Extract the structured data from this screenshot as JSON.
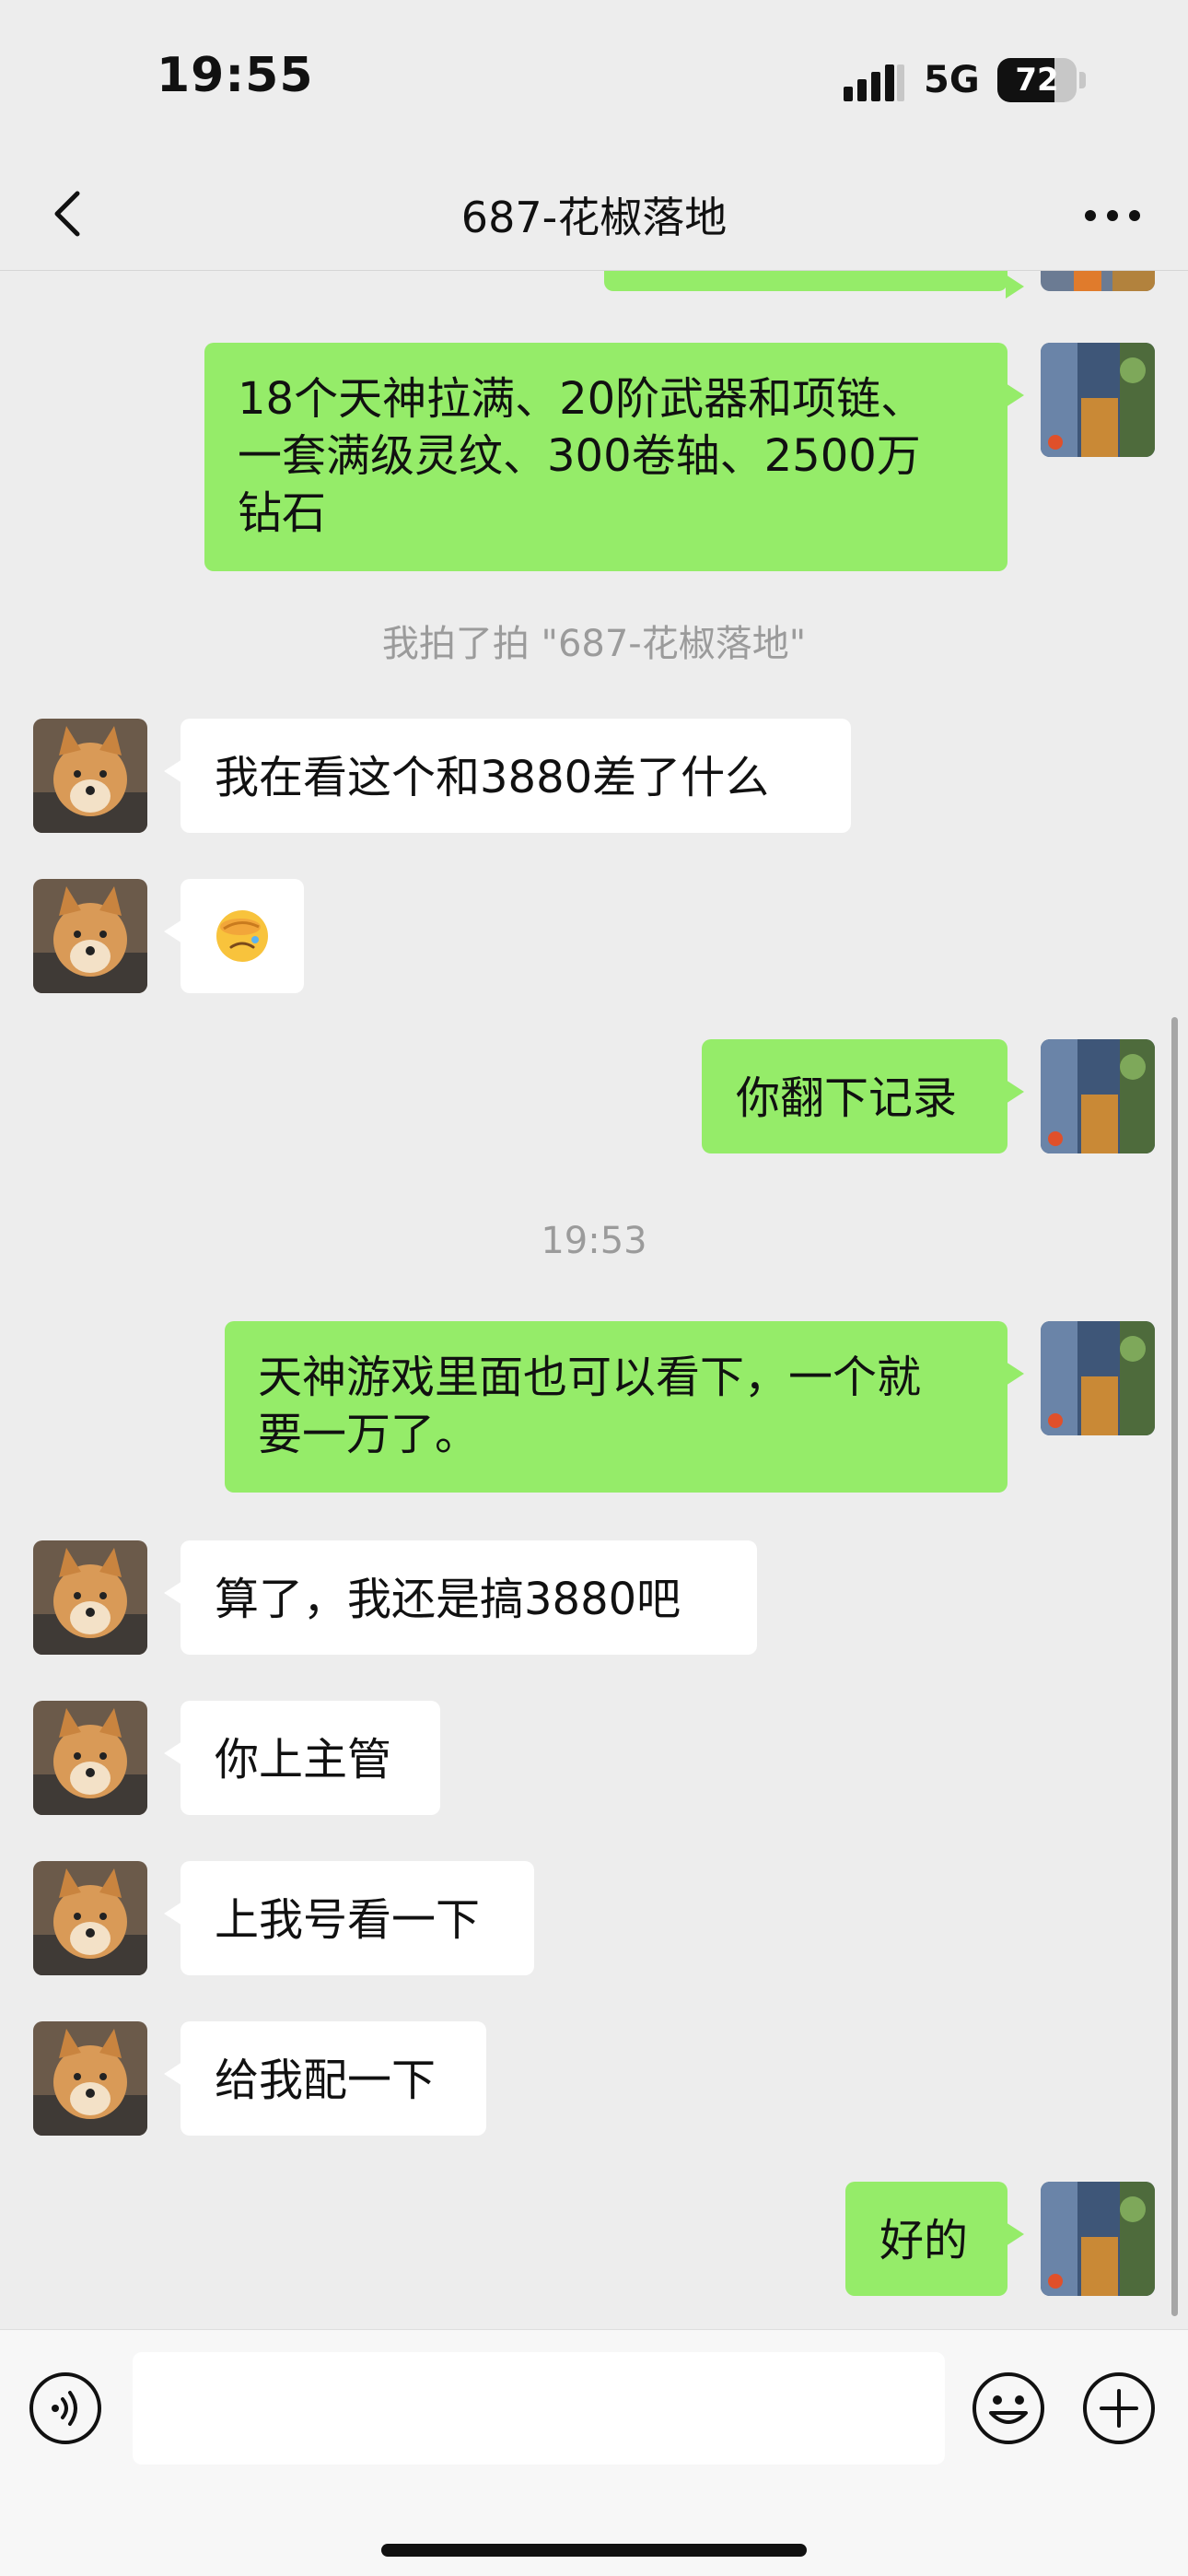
{
  "status_bar": {
    "time": "19:55",
    "network": "5G",
    "battery_percent": "72",
    "battery_level": 0.72
  },
  "nav": {
    "title": "687-花椒落地",
    "back_icon": "chevron-left-icon",
    "more_icon": "more-dots-icon"
  },
  "messages": [
    {
      "side": "out",
      "text": "18个天神拉满、20阶武器和项链、\n一套满级灵纹、300卷轴、2500万\n钻石"
    },
    {
      "type": "system",
      "text": "我拍了拍 \"687-花椒落地\""
    },
    {
      "side": "in",
      "text": "我在看这个和3880差了什么"
    },
    {
      "side": "in",
      "emoji": "facepalm-emoji"
    },
    {
      "side": "out",
      "text": "你翻下记录"
    },
    {
      "type": "time",
      "text": "19:53"
    },
    {
      "side": "out",
      "text": "天神游戏里面也可以看下，一个就\n要一万了。"
    },
    {
      "side": "in",
      "text": "算了，我还是搞3880吧"
    },
    {
      "side": "in",
      "text": "你上主管"
    },
    {
      "side": "in",
      "text": "上我号看一下"
    },
    {
      "side": "in",
      "text": "给我配一下"
    },
    {
      "side": "out",
      "text": "好的"
    }
  ],
  "input_bar": {
    "placeholder": "",
    "voice_icon": "voice-icon",
    "emoji_icon": "smiley-icon",
    "plus_icon": "plus-circle-icon"
  },
  "colors": {
    "background": "#ededed",
    "outgoing_bubble": "#95ec69",
    "incoming_bubble": "#ffffff",
    "system_text": "#9b9b9b"
  }
}
